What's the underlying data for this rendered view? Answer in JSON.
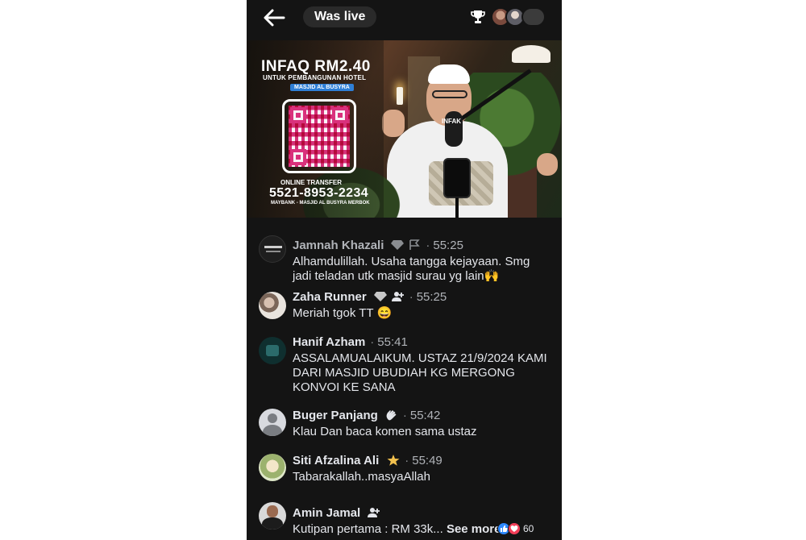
{
  "header": {
    "status_label": "Was live",
    "icons": [
      "back-arrow-icon",
      "trophy-icon",
      "viewer-avatars"
    ]
  },
  "video": {
    "overlay_title": "INFAQ RM2.40",
    "overlay_subtitle": "UNTUK PEMBANGUNAN HOTEL",
    "mosque_badge": "MASJID AL BUSYRA",
    "transfer_label": "ONLINE TRANSFER",
    "account_number": "5521-8953-2234",
    "bank_line": "MAYBANK - MASJID AL BUSYRA MERBOK",
    "mic_label": "INFAK"
  },
  "comments": [
    {
      "name": "Jamnah Khazali",
      "time": "55:25",
      "text_lines": [
        "Alhamdulillah. Usaha tangga kejayaan.  Smg",
        "jadi teladan utk masjid surau yg lain🙌"
      ],
      "badges": [
        "diamond-badge-icon",
        "flag-badge-icon"
      ]
    },
    {
      "name": "Zaha Runner",
      "time": "55:25",
      "text_lines": [
        "Meriah tgok TT 😄"
      ],
      "badges": [
        "diamond-badge-icon",
        "follower-badge-icon"
      ]
    },
    {
      "name": "Hanif Azham",
      "time": "55:41",
      "text_lines": [
        "ASSALAMUALAIKUM. USTAZ 21/9/2024 KAMI",
        "DARI MASJID UBUDIAH KG MERGONG",
        "KONVOI KE SANA"
      ],
      "badges": []
    },
    {
      "name": "Buger Panjang",
      "time": "55:42",
      "text_lines": [
        "Klau Dan baca komen sama ustaz"
      ],
      "badges": [
        "clap-badge-icon"
      ]
    },
    {
      "name": "Siti Afzalina Ali",
      "time": "55:49",
      "text_lines": [
        "Tabarakallah..masyaAllah"
      ],
      "badges": [
        "star-badge-icon"
      ]
    },
    {
      "name": "Amin Jamal",
      "time": "",
      "text_lines": [
        "Kutipan pertama : RM 33k..."
      ],
      "see_more": "See more",
      "reaction_count": "60",
      "badges": [
        "follower-badge-icon"
      ]
    }
  ]
}
